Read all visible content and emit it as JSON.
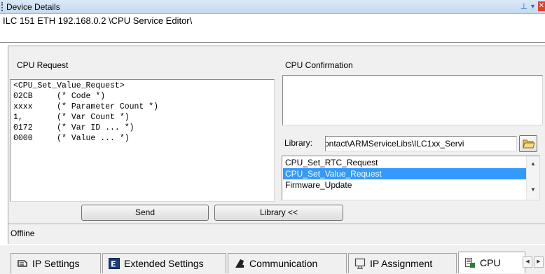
{
  "window": {
    "title": "Device Details"
  },
  "path": "ILC 151 ETH 192.168.0.2 \\CPU Service Editor\\",
  "request": {
    "label": "CPU Request",
    "lines": [
      "<CPU_Set_Value_Request>",
      "02CB     (* Code *)",
      "xxxx     (* Parameter Count *)",
      "1,       (* Var Count *)",
      "0172     (* Var ID ... *)",
      "0000     (* Value ... *)"
    ]
  },
  "confirmation": {
    "label": "CPU Confirmation",
    "value": ""
  },
  "library": {
    "label": "Library:",
    "path_visible": "ontact\\ARMServiceLibs\\ILC1xx_Servi",
    "items": [
      "CPU_Set_RTC_Request",
      "CPU_Set_Value_Request",
      "Firmware_Update"
    ],
    "selected_index": 1
  },
  "buttons": {
    "send": "Send",
    "library": "Library <<"
  },
  "status": "Offline",
  "tabs": [
    {
      "label": "IP Settings",
      "icon": "network-settings-icon"
    },
    {
      "label": "Extended Settings",
      "icon": "extended-settings-icon"
    },
    {
      "label": "Communication",
      "icon": "communication-icon"
    },
    {
      "label": "IP Assignment",
      "icon": "ip-assignment-icon"
    },
    {
      "label": "CPU",
      "icon": "cpu-service-icon",
      "active": true
    }
  ],
  "colors": {
    "selection": "#3399ff",
    "titlebar": "#c4d9ef",
    "panel": "#f0f0f0"
  }
}
